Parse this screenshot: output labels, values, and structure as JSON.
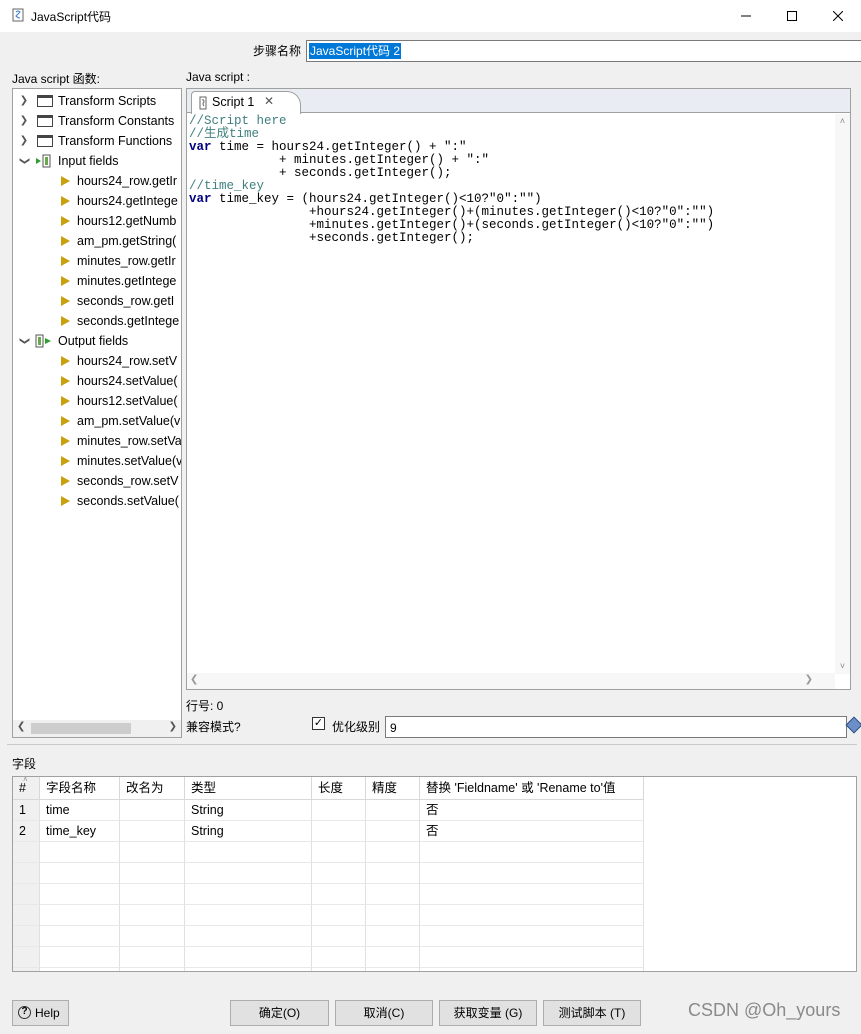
{
  "window": {
    "title": "JavaScript代码",
    "controls": [
      "minimize-icon",
      "maximize-icon",
      "close-icon"
    ]
  },
  "step": {
    "label": "步骤名称",
    "value": "JavaScript代码 2"
  },
  "left_panel": {
    "label": "Java script 函数:"
  },
  "editor_panel": {
    "label": "Java script :"
  },
  "tree": {
    "groups": [
      {
        "label": "Transform Scripts",
        "icon": "folder-icon",
        "expanded": false
      },
      {
        "label": "Transform Constants",
        "icon": "folder-icon",
        "expanded": false
      },
      {
        "label": "Transform Functions",
        "icon": "folder-icon",
        "expanded": false
      },
      {
        "label": "Input fields",
        "icon": "input-fields-icon",
        "expanded": true,
        "items": [
          "hours24_row.getIr",
          "hours24.getIntege",
          "hours12.getNumb",
          "am_pm.getString(",
          "minutes_row.getIr",
          "minutes.getIntege",
          "seconds_row.getI",
          "seconds.getIntege"
        ]
      },
      {
        "label": "Output fields",
        "icon": "output-fields-icon",
        "expanded": true,
        "items": [
          "hours24_row.setV",
          "hours24.setValue(",
          "hours12.setValue(",
          "am_pm.setValue(v",
          "minutes_row.setVa",
          "minutes.setValue(v",
          "seconds_row.setV",
          "seconds.setValue("
        ]
      }
    ]
  },
  "script_tab": {
    "label": "Script 1"
  },
  "code_lines": [
    "//Script here",
    "//生成time",
    "var time = hours24.getInteger() + \":\"",
    "            + minutes.getInteger() + \":\"",
    "            + seconds.getInteger();",
    "//time_key",
    "var time_key = (hours24.getInteger()<10?\"0\":\"\")",
    "                +hours24.getInteger()+(minutes.getInteger()<10?\"0\":\"\")",
    "                +minutes.getInteger()+(seconds.getInteger()<10?\"0\":\"\")",
    "                +seconds.getInteger();"
  ],
  "status": {
    "line_number": "行号: 0",
    "compat_label": "兼容模式?",
    "optimize_checked": true,
    "optimize_label": "优化级别",
    "optimize_value": "9"
  },
  "fields": {
    "section_label": "字段",
    "columns": [
      "#",
      "字段名称",
      "改名为",
      "类型",
      "长度",
      "精度",
      "替换 'Fieldname' 或 'Rename to'值"
    ],
    "rows": [
      [
        "1",
        "time",
        "",
        "String",
        "",
        "",
        "否"
      ],
      [
        "2",
        "time_key",
        "",
        "String",
        "",
        "",
        "否"
      ]
    ]
  },
  "buttons": {
    "help": "Help",
    "ok": "确定(O)",
    "cancel": "取消(C)",
    "get_vars": "获取变量 (G)",
    "test": "测试脚本 (T)"
  },
  "watermark": "CSDN @Oh_yours"
}
